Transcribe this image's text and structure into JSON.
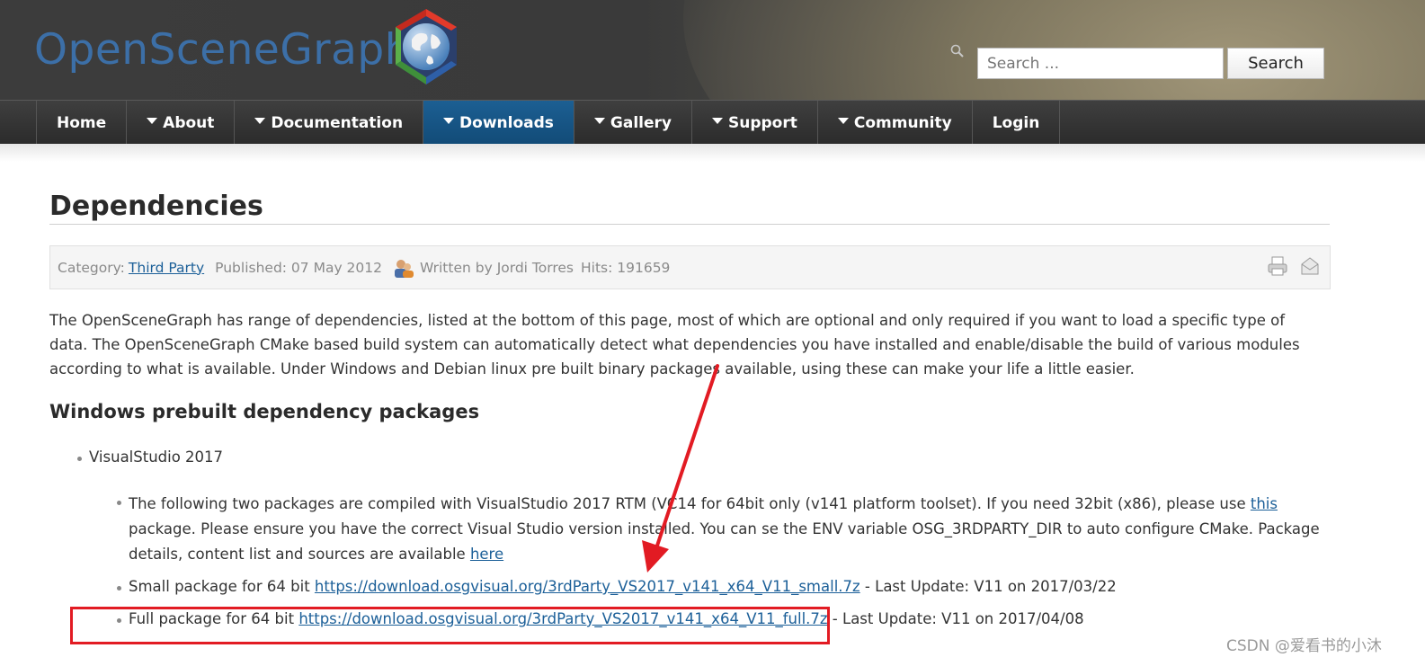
{
  "header": {
    "logo_text": "OpenSceneGraph",
    "search": {
      "placeholder": "Search ...",
      "button": "Search"
    }
  },
  "nav": {
    "items": [
      {
        "label": "Home",
        "has_dropdown": false,
        "active": false
      },
      {
        "label": "About",
        "has_dropdown": true,
        "active": false
      },
      {
        "label": "Documentation",
        "has_dropdown": true,
        "active": false
      },
      {
        "label": "Downloads",
        "has_dropdown": true,
        "active": true
      },
      {
        "label": "Gallery",
        "has_dropdown": true,
        "active": false
      },
      {
        "label": "Support",
        "has_dropdown": true,
        "active": false
      },
      {
        "label": "Community",
        "has_dropdown": true,
        "active": false
      },
      {
        "label": "Login",
        "has_dropdown": false,
        "active": false
      }
    ],
    "active_color": "#1c5f93"
  },
  "article": {
    "title": "Dependencies",
    "info": {
      "category_label": "Category:",
      "category": "Third Party",
      "published": "Published: 07 May 2012",
      "author": "Written by Jordi Torres",
      "hits": "Hits: 191659",
      "icons": [
        "print-icon",
        "email-icon"
      ]
    },
    "intro": "The OpenSceneGraph has range of dependencies, listed at the bottom of this page, most of which are optional and only required if you want to load a specific type of data. The OpenSceneGraph CMake based build system can automatically detect what dependencies you have installed and enable/disable the build of various modules according to what is available. Under Windows and Debian linux pre built binary packages available, using these can make your life a little easier.",
    "section_heading": "Windows prebuilt dependency packages",
    "vs_item": "VisualStudio 2017",
    "note": {
      "part1": "The following two packages are compiled with VisualStudio 2017 RTM (VC14",
      "part1b": " for 64bit only (v141 platform toolset). If you need 32bit (x86), please use ",
      "link1": "this ",
      "part2": "package. Please ensure you have the correct Visual Studio version installed. You can ",
      "part2b": "se the ENV variable OSG_3RDPARTY_DIR to auto configure CMake. Package details, content list and sources are available ",
      "link2": "here"
    },
    "small_package": {
      "prefix": "Small package for 64 bit ",
      "url": "https://download.osgvisual.org/3rdParty_VS2017_v141_x64_V11_small.7z",
      "suffix": " - Last Update: V11 on 2017/03/22"
    },
    "full_package": {
      "prefix": "Full package for 64 bit ",
      "url": "https://download.osgvisual.org/3rdParty_VS2017_v141_x64_V11_full.7z",
      "suffix": " - Last Update: V11 on 2017/04/08"
    }
  },
  "annotation": {
    "color": "#e21b23",
    "watermark": "CSDN @爱看书的小沐"
  }
}
